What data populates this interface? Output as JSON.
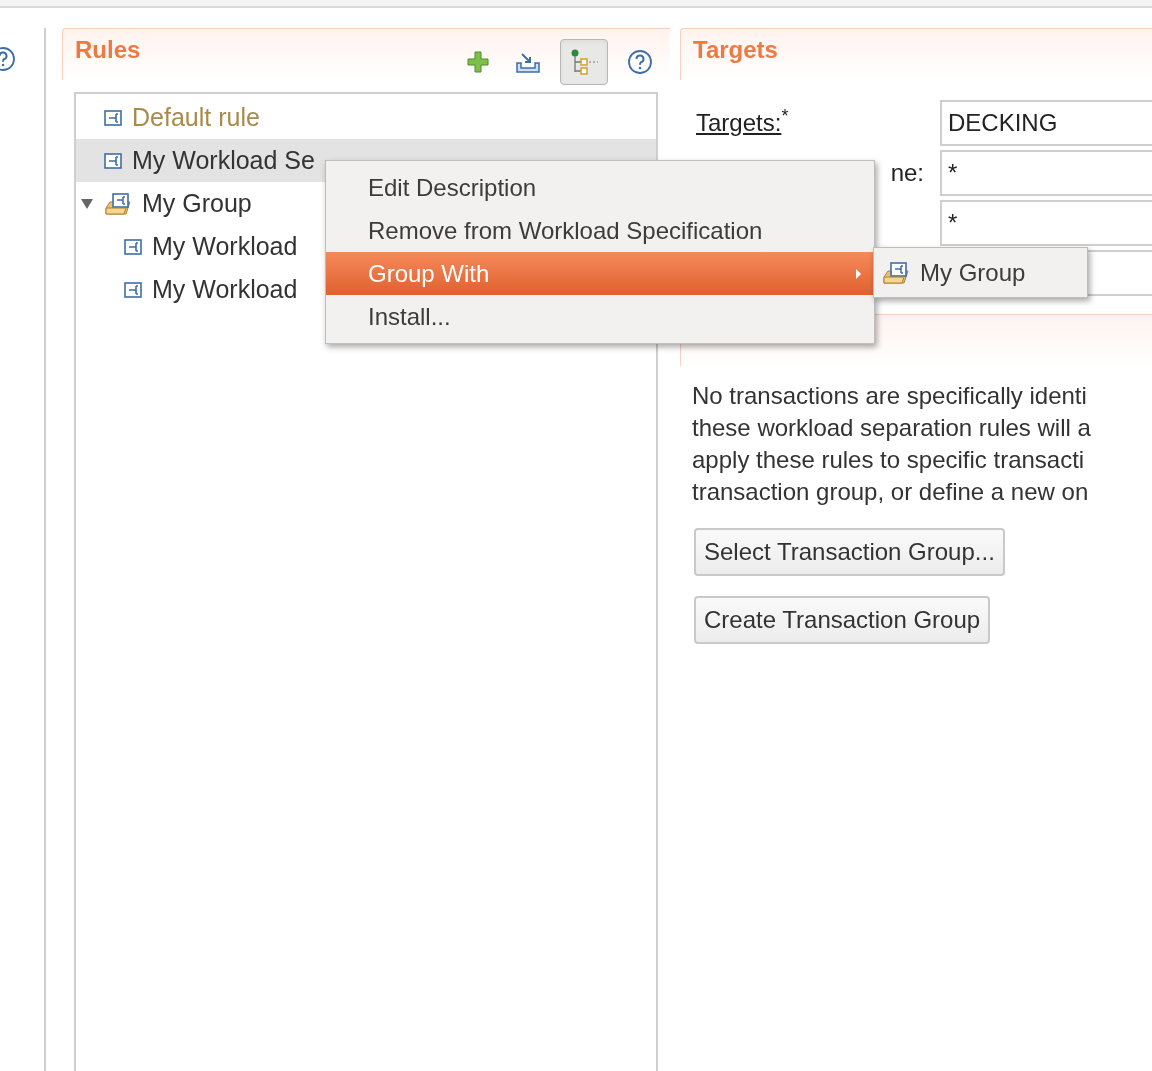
{
  "rules_panel": {
    "title": "Rules",
    "toolbar": [
      {
        "kind": "add",
        "selected": false
      },
      {
        "kind": "import",
        "selected": false
      },
      {
        "kind": "tree",
        "selected": true
      },
      {
        "kind": "help",
        "selected": false
      }
    ],
    "tree": [
      {
        "label": "Default rule",
        "kind": "default",
        "selected": false
      },
      {
        "label": "My Workload Se",
        "kind": "rule",
        "selected": true
      },
      {
        "label": "My Group",
        "kind": "group",
        "selected": false,
        "expanded": true,
        "children": [
          {
            "label": "My Workload",
            "kind": "rule",
            "selected": false
          },
          {
            "label": "My Workload",
            "kind": "rule",
            "selected": false
          }
        ]
      }
    ]
  },
  "targets_panel": {
    "title": "Targets",
    "fields": [
      {
        "kind": "text",
        "label": "Targets:$^{*}$",
        "value": "DECKING"
      },
      {
        "kind": "text",
        "label": "ne:",
        "value": "*"
      },
      {
        "kind": "text",
        "value": "*"
      },
      {
        "kind": "text"
      }
    ],
    "transactions": {
      "text_lines": [
        "No transactions are specifically identi",
        "these workload separation rules will a",
        "apply these rules to specific transacti",
        "transaction group, or define a new on"
      ],
      "buttons": [
        "Select Transaction Group...",
        "Create Transaction Group"
      ]
    }
  },
  "context_menu": {
    "items": [
      {
        "label": "Edit Description",
        "selected": false
      },
      {
        "label": "Remove from Workload Specification",
        "selected": false
      },
      {
        "label": "Group With",
        "selected": true,
        "submenu": true
      },
      {
        "label": "Install...",
        "selected": false
      }
    ],
    "submenu": {
      "items": [
        {
          "label": "My Group",
          "kind": "group"
        }
      ]
    }
  }
}
